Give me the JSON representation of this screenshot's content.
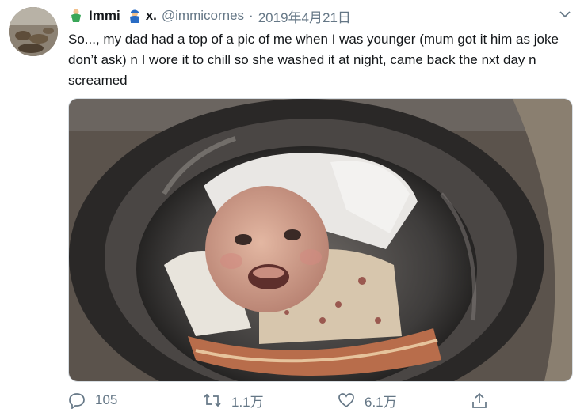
{
  "tweet": {
    "author_name": "Immi",
    "author_suffix": "x.",
    "handle": "@immicornes",
    "separator": "·",
    "date": "2019年4月21日",
    "text": "So..., my dad had a top of a pic of me when I was younger (mum got it him as joke don’t ask) n I wore it to chill so she washed it at night, came back the nxt day n screamed",
    "media_alt": "baby face printed shirt inside a washing machine drum"
  },
  "actions": {
    "reply_count": "105",
    "retweet_count": "1.1万",
    "like_count": "6.1万"
  },
  "colors": {
    "text": "#14171a",
    "secondary": "#657786",
    "border": "#d8dee3"
  },
  "icons": {
    "reply": "reply-icon",
    "retweet": "retweet-icon",
    "like": "heart-icon",
    "share": "share-icon",
    "menu": "chevron-down-icon"
  }
}
